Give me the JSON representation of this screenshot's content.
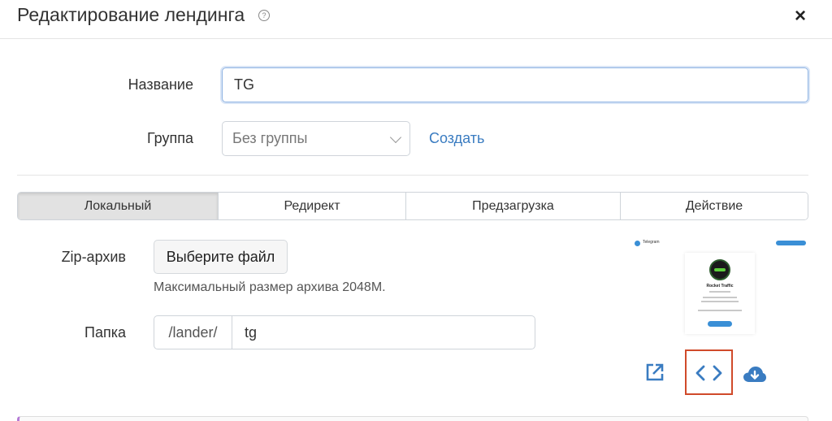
{
  "header": {
    "title": "Редактирование лендинга",
    "help_icon": "question-circle-icon",
    "close_label": "×"
  },
  "form": {
    "name_label": "Название",
    "name_value": "TG",
    "group_label": "Группа",
    "group_value": "Без группы",
    "create_link": "Создать"
  },
  "tabs": [
    {
      "label": "Локальный",
      "active": true
    },
    {
      "label": "Редирект",
      "active": false
    },
    {
      "label": "Предзагрузка",
      "active": false
    },
    {
      "label": "Действие",
      "active": false
    }
  ],
  "upload": {
    "zip_label": "Zip-архив",
    "choose_file_button": "Выберите файл",
    "hint": "Максимальный размер архива 2048M."
  },
  "folder": {
    "label": "Папка",
    "prefix": "/lander/",
    "value": "tg"
  },
  "preview": {
    "app_name": "Telegram",
    "channel_name": "Rocket Traffic"
  },
  "actions": {
    "open_icon": "external-link-icon",
    "code_icon": "code-brackets-icon",
    "download_icon": "cloud-download-icon"
  },
  "colors": {
    "accent_link": "#3a7cc1",
    "highlight_border": "#d04a2a",
    "icon_blue": "#3a7cc1"
  }
}
